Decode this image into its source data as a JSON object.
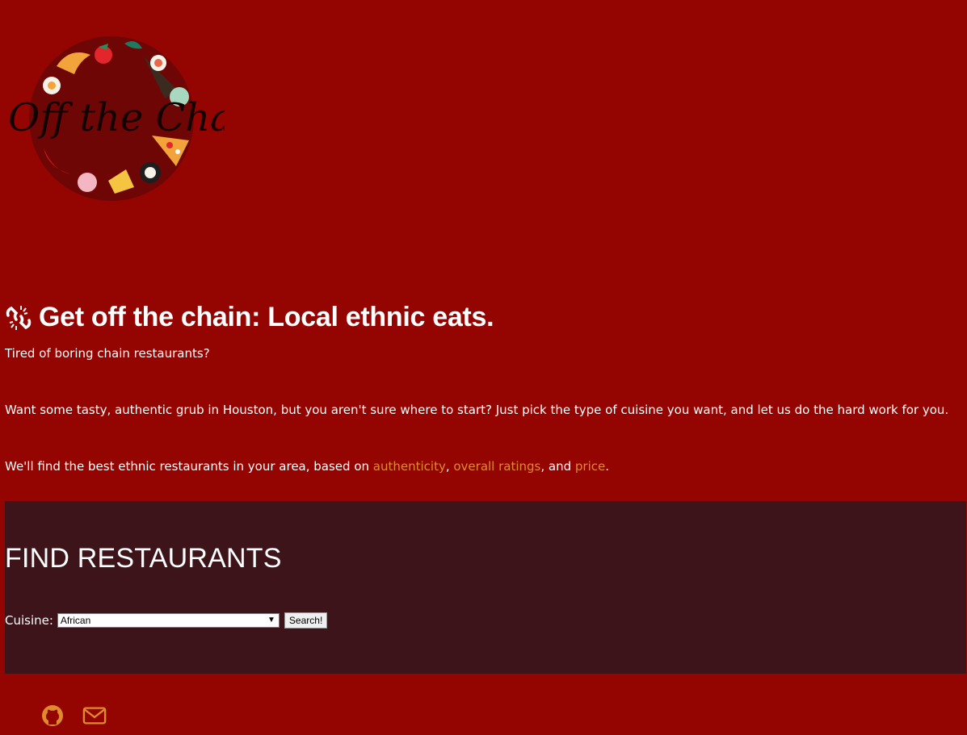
{
  "logo": {
    "text": "Off the Chain",
    "colors": {
      "circle": "#6e0606",
      "text": "#140000"
    }
  },
  "hero": {
    "icon": "broken-chain-icon",
    "title": "Get off the chain: Local ethnic eats.",
    "para1": "Tired of boring chain restaurants?",
    "para2": "Want some tasty, authentic grub in Houston, but you aren't sure where to start? Just pick the type of cuisine you want, and let us do the hard work for you.",
    "para3": {
      "prefix": "We'll find the best ethnic restaurants in your area, based on ",
      "link1": "authenticity",
      "sep1": ", ",
      "link2": "overall ratings",
      "sep2": ", and ",
      "link3": "price",
      "suffix": "."
    }
  },
  "search": {
    "title": "FIND RESTAURANTS",
    "cuisine_label": "Cuisine:",
    "cuisine_selected": "African",
    "button_label": "Search!"
  },
  "footer": {
    "icons": [
      "github-icon",
      "mail-icon"
    ]
  },
  "colors": {
    "background": "#940400",
    "panel": "#3d141a",
    "link": "#e08a2e",
    "text": "#ffffff"
  }
}
